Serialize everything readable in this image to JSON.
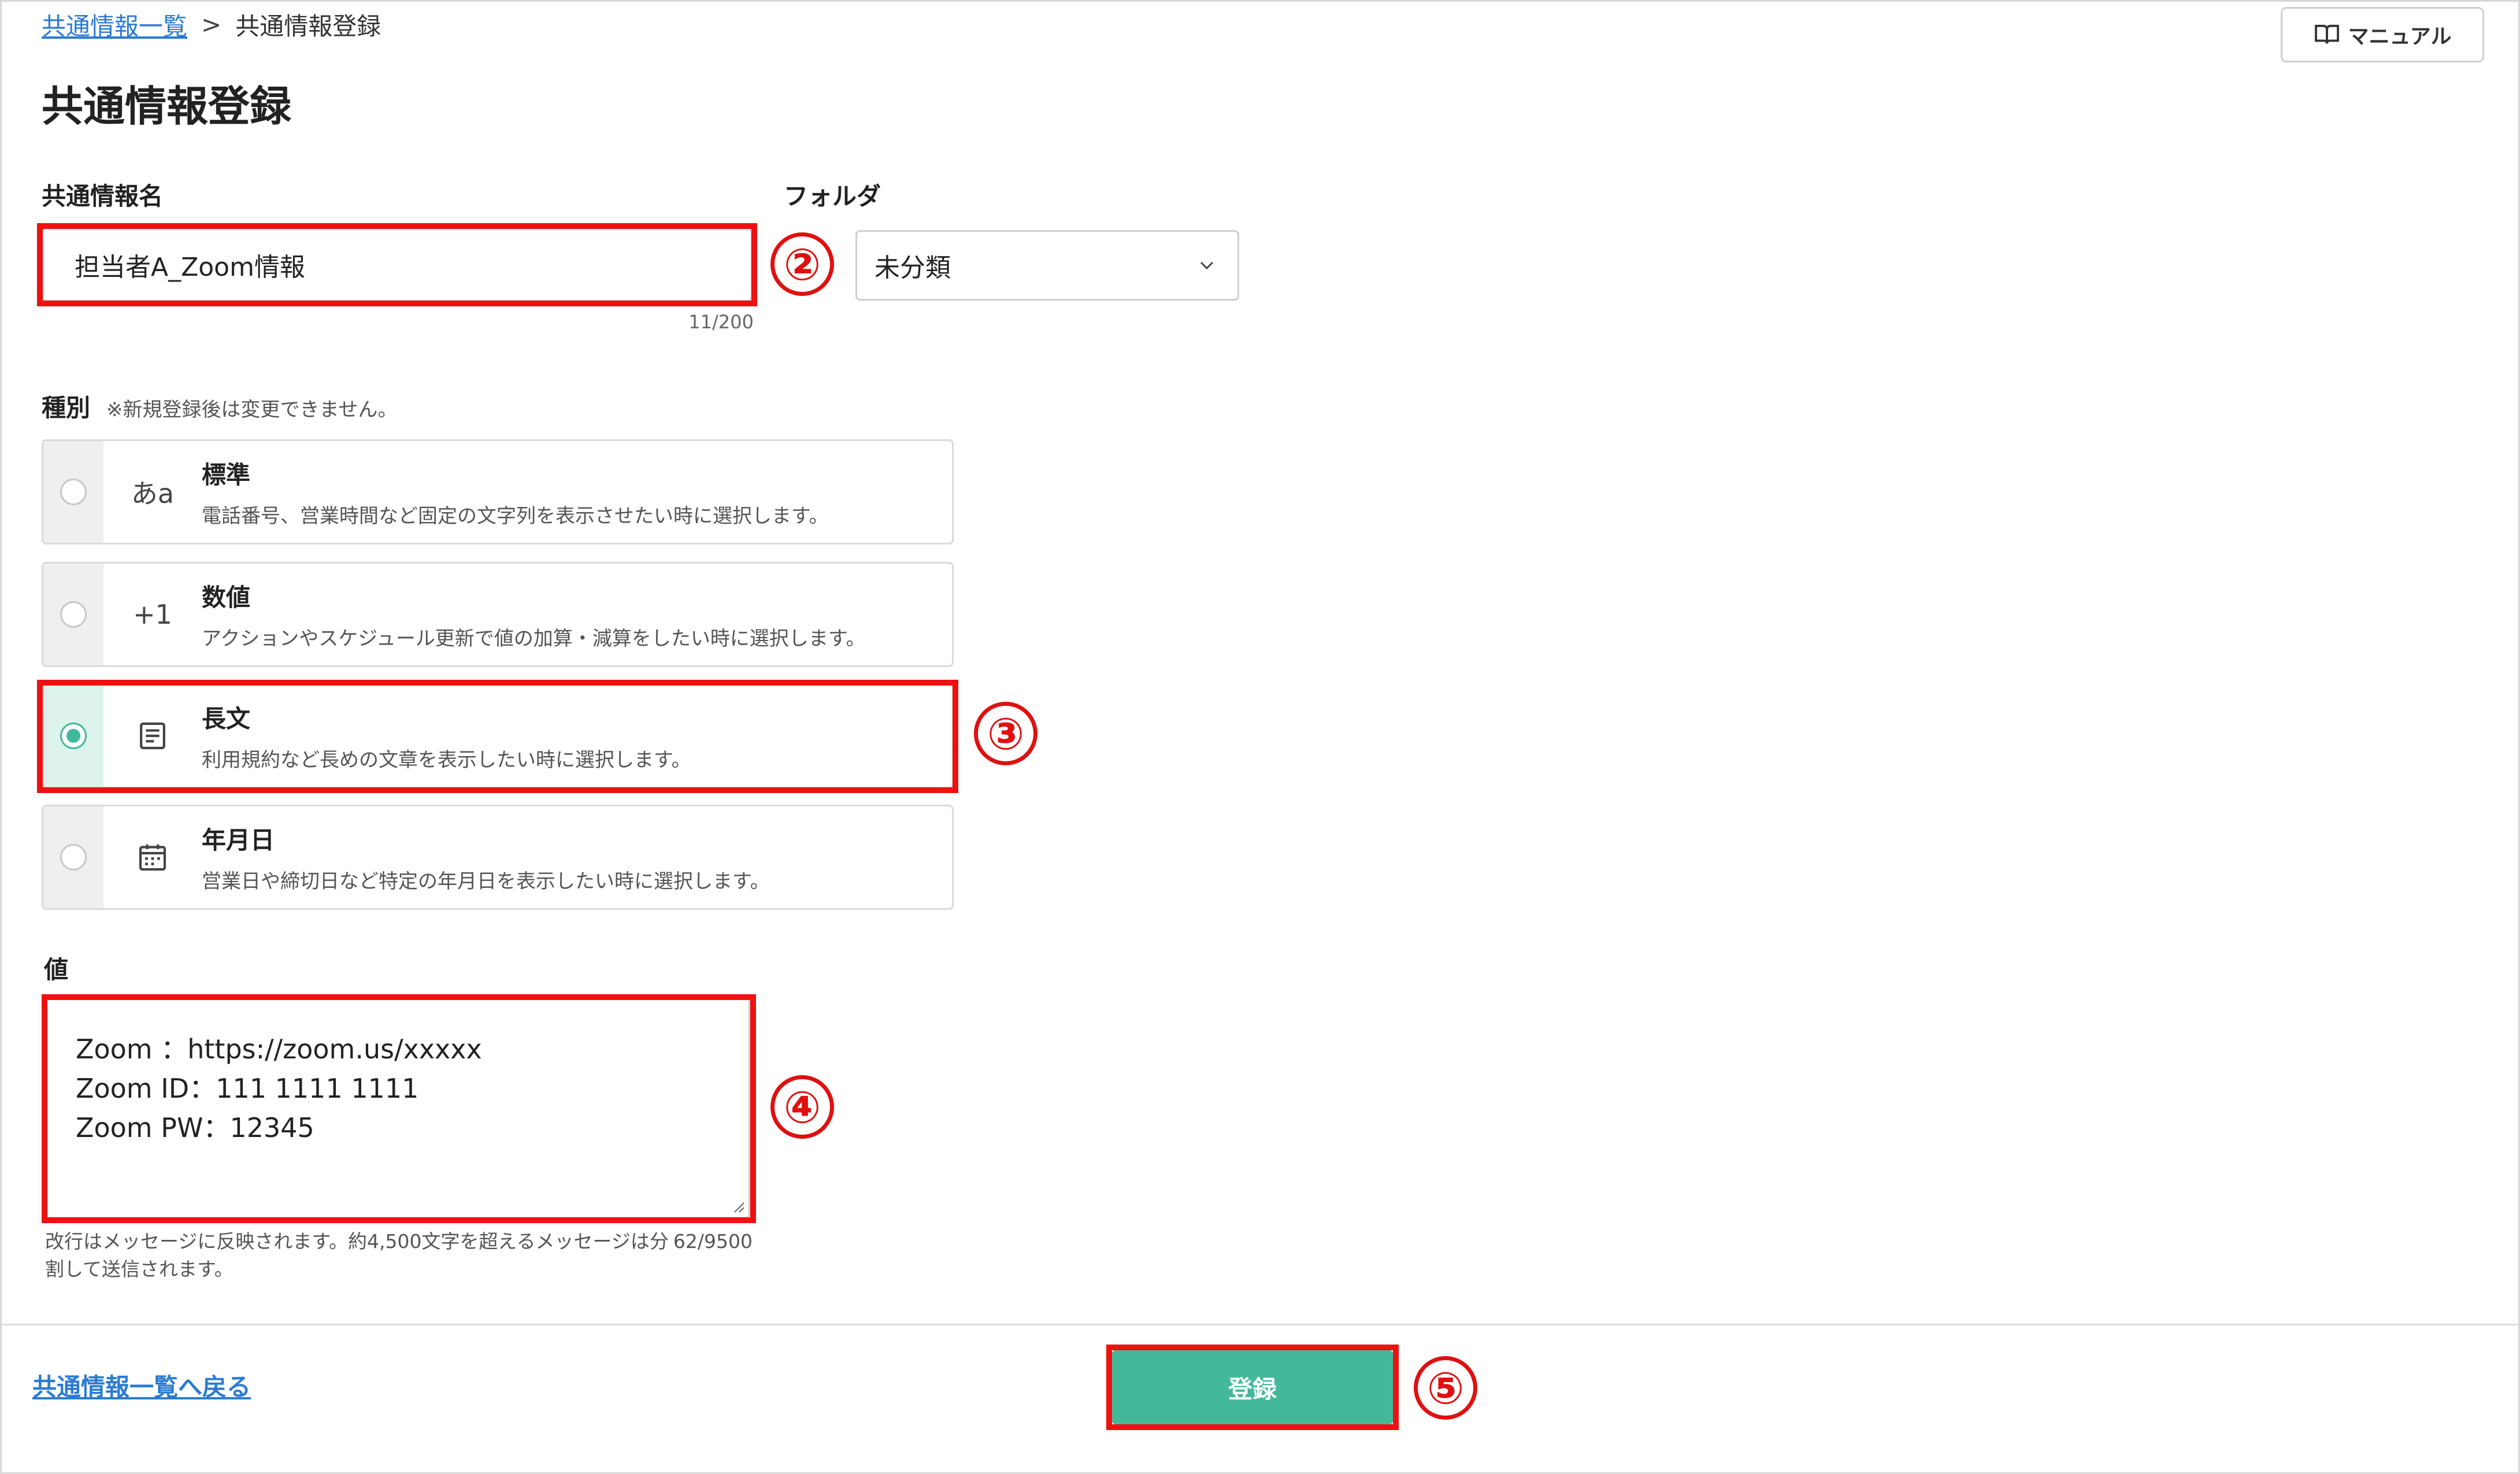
{
  "breadcrumb": {
    "parent": "共通情報一覧",
    "separator": ">",
    "current": "共通情報登録"
  },
  "manual_button": {
    "label": "マニュアル",
    "icon": "book-icon"
  },
  "page_title": "共通情報登録",
  "name_field": {
    "label": "共通情報名",
    "value": "担当者A_Zoom情報",
    "counter": "11/200"
  },
  "folder_field": {
    "label": "フォルダ",
    "value": "未分類"
  },
  "type_field": {
    "label": "種別",
    "note": "※新規登録後は変更できません。",
    "options": [
      {
        "icon": "あa",
        "title": "標準",
        "desc": "電話番号、営業時間など固定の文字列を表示させたい時に選択します。",
        "selected": false
      },
      {
        "icon": "+1",
        "title": "数値",
        "desc": "アクションやスケジュール更新で値の加算・減算をしたい時に選択します。",
        "selected": false
      },
      {
        "icon": "document-icon",
        "title": "長文",
        "desc": "利用規約など長めの文章を表示したい時に選択します。",
        "selected": true
      },
      {
        "icon": "calendar-icon",
        "title": "年月日",
        "desc": "営業日や締切日など特定の年月日を表示したい時に選択します。",
        "selected": false
      }
    ]
  },
  "value_field": {
    "label": "値",
    "lines": [
      "Zoom ：https://zoom.us/xxxxx",
      "Zoom ID：111 1111 1111",
      "Zoom PW：12345"
    ],
    "help": "改行はメッセージに反映されます。約4,500文字を超えるメッセージは分割して送信されます。",
    "counter": "62/9500"
  },
  "footer": {
    "back_link": "共通情報一覧へ戻る",
    "submit_label": "登録"
  },
  "markers": [
    "②",
    "③",
    "④",
    "⑤"
  ],
  "colors": {
    "accent": "#44b99a",
    "link": "#2b7bd0",
    "highlight": "#ee1111"
  }
}
